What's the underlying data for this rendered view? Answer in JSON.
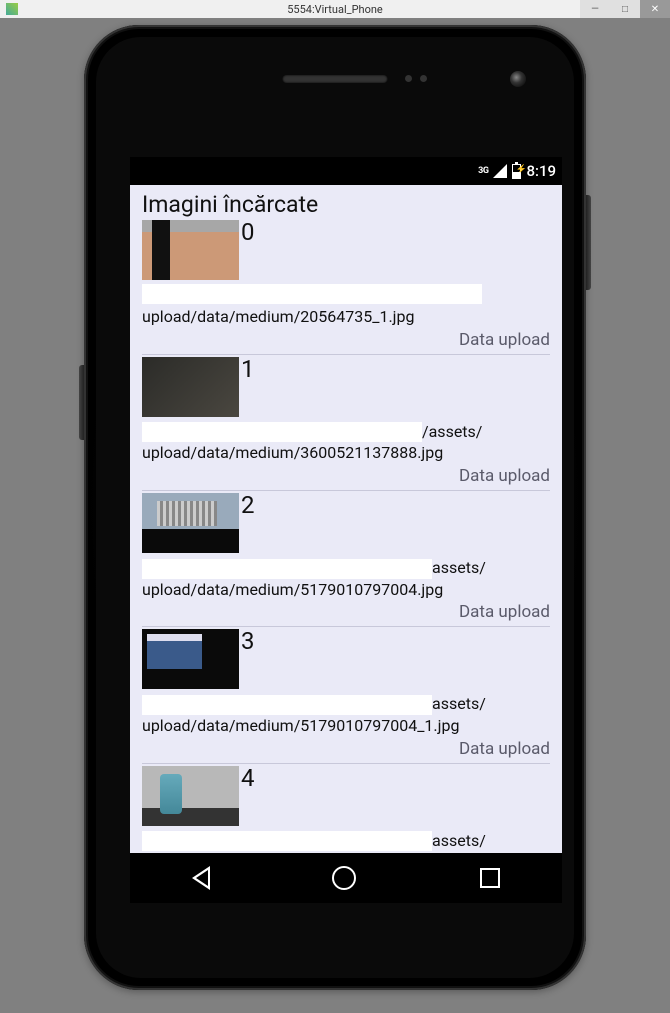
{
  "window": {
    "title": "5554:Virtual_Phone"
  },
  "status_bar": {
    "network": "3G",
    "time": "8:19"
  },
  "app": {
    "title": "Imagini încărcate"
  },
  "items": [
    {
      "index": "0",
      "url_visible": "upload/data/medium/20564735_1.jpg",
      "url_partial_suffix": "",
      "status": "Data upload"
    },
    {
      "index": "1",
      "url_partial_suffix": "/assets/",
      "url_visible": "upload/data/medium/3600521137888.jpg",
      "status": "Data upload"
    },
    {
      "index": "2",
      "url_partial_suffix": "assets/",
      "url_visible": "upload/data/medium/5179010797004.jpg",
      "status": "Data upload"
    },
    {
      "index": "3",
      "url_partial_suffix": "assets/",
      "url_visible": "upload/data/medium/5179010797004_1.jpg",
      "status": "Data upload"
    },
    {
      "index": "4",
      "url_partial_suffix": "assets/",
      "url_visible": "",
      "status": ""
    }
  ]
}
